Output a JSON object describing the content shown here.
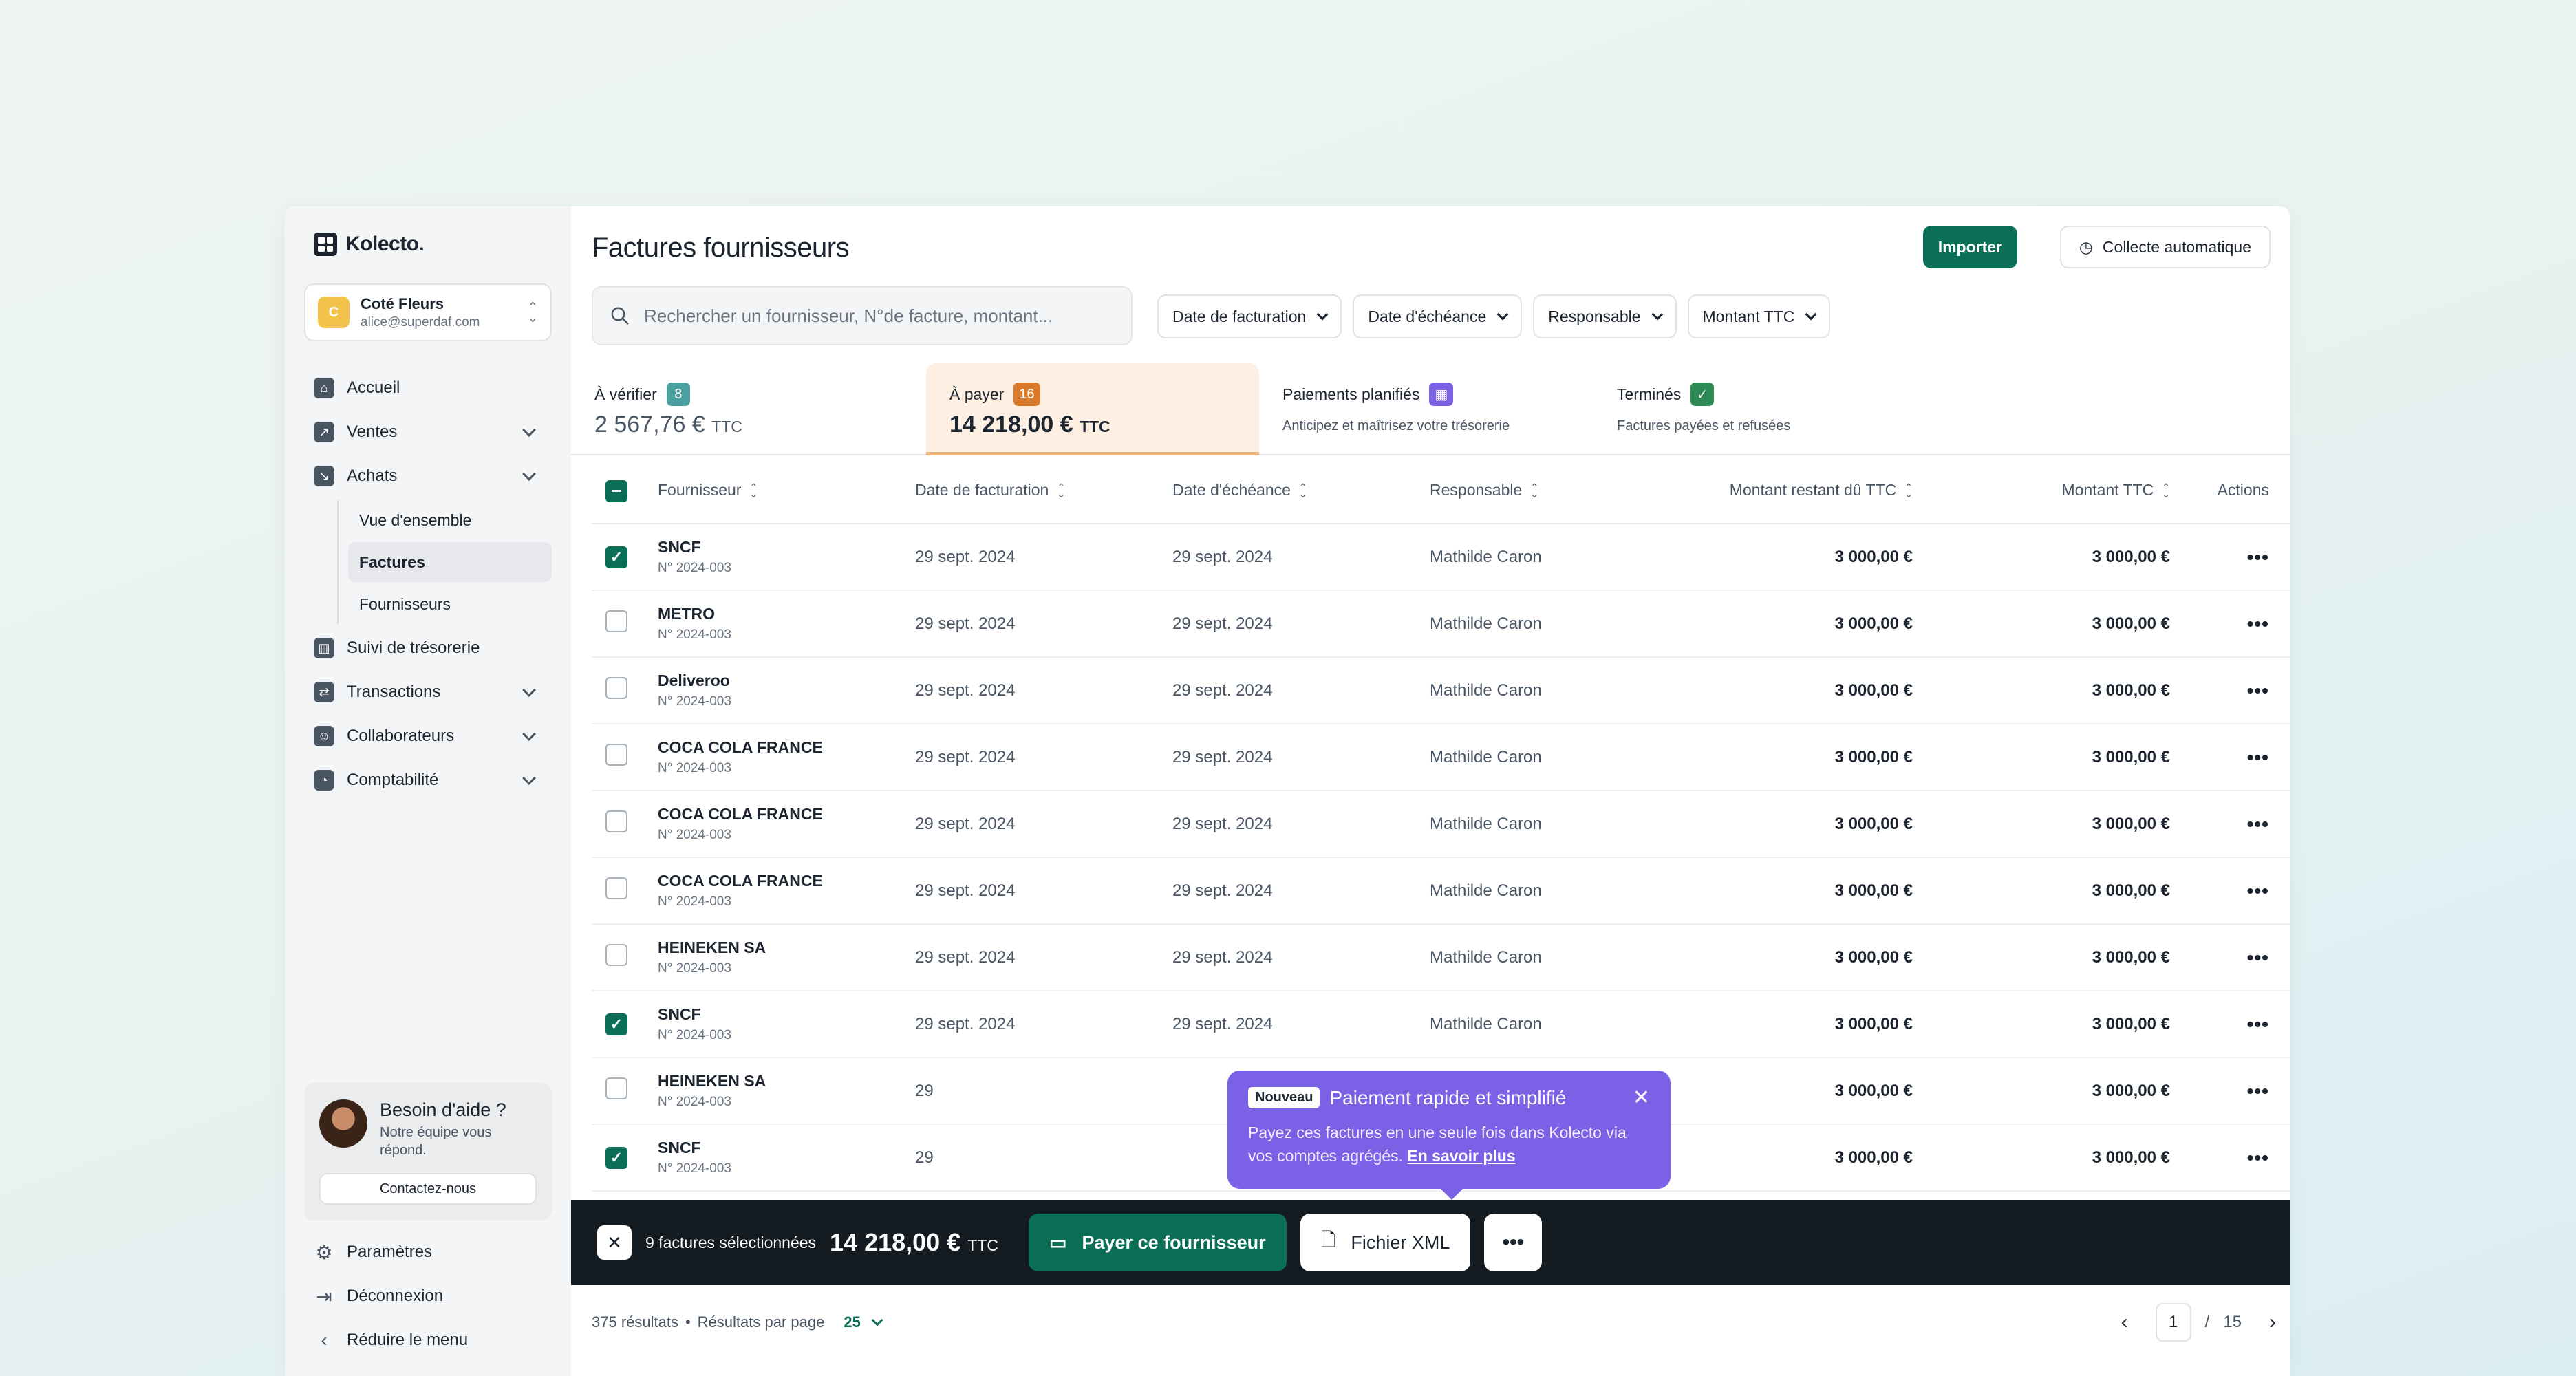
{
  "app": {
    "logo": "Kolecto."
  },
  "company": {
    "initial": "C",
    "name": "Coté Fleurs",
    "email": "alice@superdaf.com"
  },
  "nav": {
    "accueil": "Accueil",
    "ventes": "Ventes",
    "achats": "Achats",
    "achats_sub": [
      "Vue d'ensemble",
      "Factures",
      "Fournisseurs"
    ],
    "tresorerie": "Suivi de trésorerie",
    "transactions": "Transactions",
    "collaborateurs": "Collaborateurs",
    "comptabilite": "Comptabilité"
  },
  "help": {
    "title": "Besoin d'aide ?",
    "subtitle": "Notre équipe vous répond.",
    "button": "Contactez-nous"
  },
  "bottom_nav": {
    "parametres": "Paramètres",
    "deconnexion": "Déconnexion",
    "reduire": "Réduire le menu"
  },
  "header": {
    "title": "Factures fournisseurs",
    "import_label": "Importer",
    "collect_label": "Collecte automatique"
  },
  "search": {
    "placeholder": "Rechercher un fournisseur, N°de facture, montant..."
  },
  "filters": [
    "Date de facturation",
    "Date d'échéance",
    "Responsable",
    "Montant TTC"
  ],
  "tabs": {
    "verifier": {
      "label": "À vérifier",
      "count": "8",
      "amount": "2 567,76 €",
      "unit": "TTC"
    },
    "payer": {
      "label": "À payer",
      "count": "16",
      "amount": "14 218,00 €",
      "unit": "TTC"
    },
    "planifies": {
      "label": "Paiements planifiés",
      "desc": "Anticipez et maîtrisez votre trésorerie"
    },
    "termines": {
      "label": "Terminés",
      "desc": "Factures payées et refusées"
    }
  },
  "table": {
    "headers": [
      "Fournisseur",
      "Date de facturation",
      "Date d'échéance",
      "Responsable",
      "Montant restant dû TTC",
      "Montant TTC",
      "Actions"
    ],
    "rows": [
      {
        "supplier": "SNCF",
        "number": "N° 2024-003",
        "invoice_date": "29 sept. 2024",
        "due_date": "29 sept. 2024",
        "owner": "Mathilde Caron",
        "remaining": "3 000,00 €",
        "total": "3 000,00 €",
        "checked": true
      },
      {
        "supplier": "METRO",
        "number": "N° 2024-003",
        "invoice_date": "29 sept. 2024",
        "due_date": "29 sept. 2024",
        "owner": "Mathilde Caron",
        "remaining": "3 000,00 €",
        "total": "3 000,00 €",
        "checked": false
      },
      {
        "supplier": "Deliveroo",
        "number": "N° 2024-003",
        "invoice_date": "29 sept. 2024",
        "due_date": "29 sept. 2024",
        "owner": "Mathilde Caron",
        "remaining": "3 000,00 €",
        "total": "3 000,00 €",
        "checked": false
      },
      {
        "supplier": "COCA COLA FRANCE",
        "number": "N° 2024-003",
        "invoice_date": "29 sept. 2024",
        "due_date": "29 sept. 2024",
        "owner": "Mathilde Caron",
        "remaining": "3 000,00 €",
        "total": "3 000,00 €",
        "checked": false
      },
      {
        "supplier": "COCA COLA FRANCE",
        "number": "N° 2024-003",
        "invoice_date": "29 sept. 2024",
        "due_date": "29 sept. 2024",
        "owner": "Mathilde Caron",
        "remaining": "3 000,00 €",
        "total": "3 000,00 €",
        "checked": false
      },
      {
        "supplier": "COCA COLA FRANCE",
        "number": "N° 2024-003",
        "invoice_date": "29 sept. 2024",
        "due_date": "29 sept. 2024",
        "owner": "Mathilde Caron",
        "remaining": "3 000,00 €",
        "total": "3 000,00 €",
        "checked": false
      },
      {
        "supplier": "HEINEKEN SA",
        "number": "N° 2024-003",
        "invoice_date": "29 sept. 2024",
        "due_date": "29 sept. 2024",
        "owner": "Mathilde Caron",
        "remaining": "3 000,00 €",
        "total": "3 000,00 €",
        "checked": false
      },
      {
        "supplier": "SNCF",
        "number": "N° 2024-003",
        "invoice_date": "29 sept. 2024",
        "due_date": "29 sept. 2024",
        "owner": "Mathilde Caron",
        "remaining": "3 000,00 €",
        "total": "3 000,00 €",
        "checked": true
      },
      {
        "supplier": "HEINEKEN SA",
        "number": "N° 2024-003",
        "invoice_date": "29",
        "due_date": "",
        "owner": "Mathilde Caron",
        "remaining": "3 000,00 €",
        "total": "3 000,00 €",
        "checked": false
      },
      {
        "supplier": "SNCF",
        "number": "N° 2024-003",
        "invoice_date": "29",
        "due_date": "",
        "owner": "Mathilde Caron",
        "remaining": "3 000,00 €",
        "total": "3 000,00 €",
        "checked": true
      }
    ]
  },
  "tooltip": {
    "badge": "Nouveau",
    "title": "Paiement rapide et simplifié",
    "body": "Payez ces factures en une seule fois dans Kolecto via vos comptes agrégés.",
    "link": "En savoir plus"
  },
  "action_bar": {
    "selected_text": "9 factures sélectionnées",
    "amount": "14 218,00 €",
    "unit": "TTC",
    "pay_label": "Payer ce fournisseur",
    "xml_label": "Fichier XML"
  },
  "footer": {
    "results": "375 résultats",
    "per_page_label": "Résultats par page",
    "per_page": "25",
    "page": "1",
    "total_pages": "15"
  },
  "colors": {
    "accent": "#0b6e57",
    "verify_badge": "#4a9fa0",
    "pay_badge": "#d97a2b",
    "planned_badge": "#7b61e6",
    "done_badge": "#2e8b57",
    "tooltip": "#7b61e6"
  }
}
